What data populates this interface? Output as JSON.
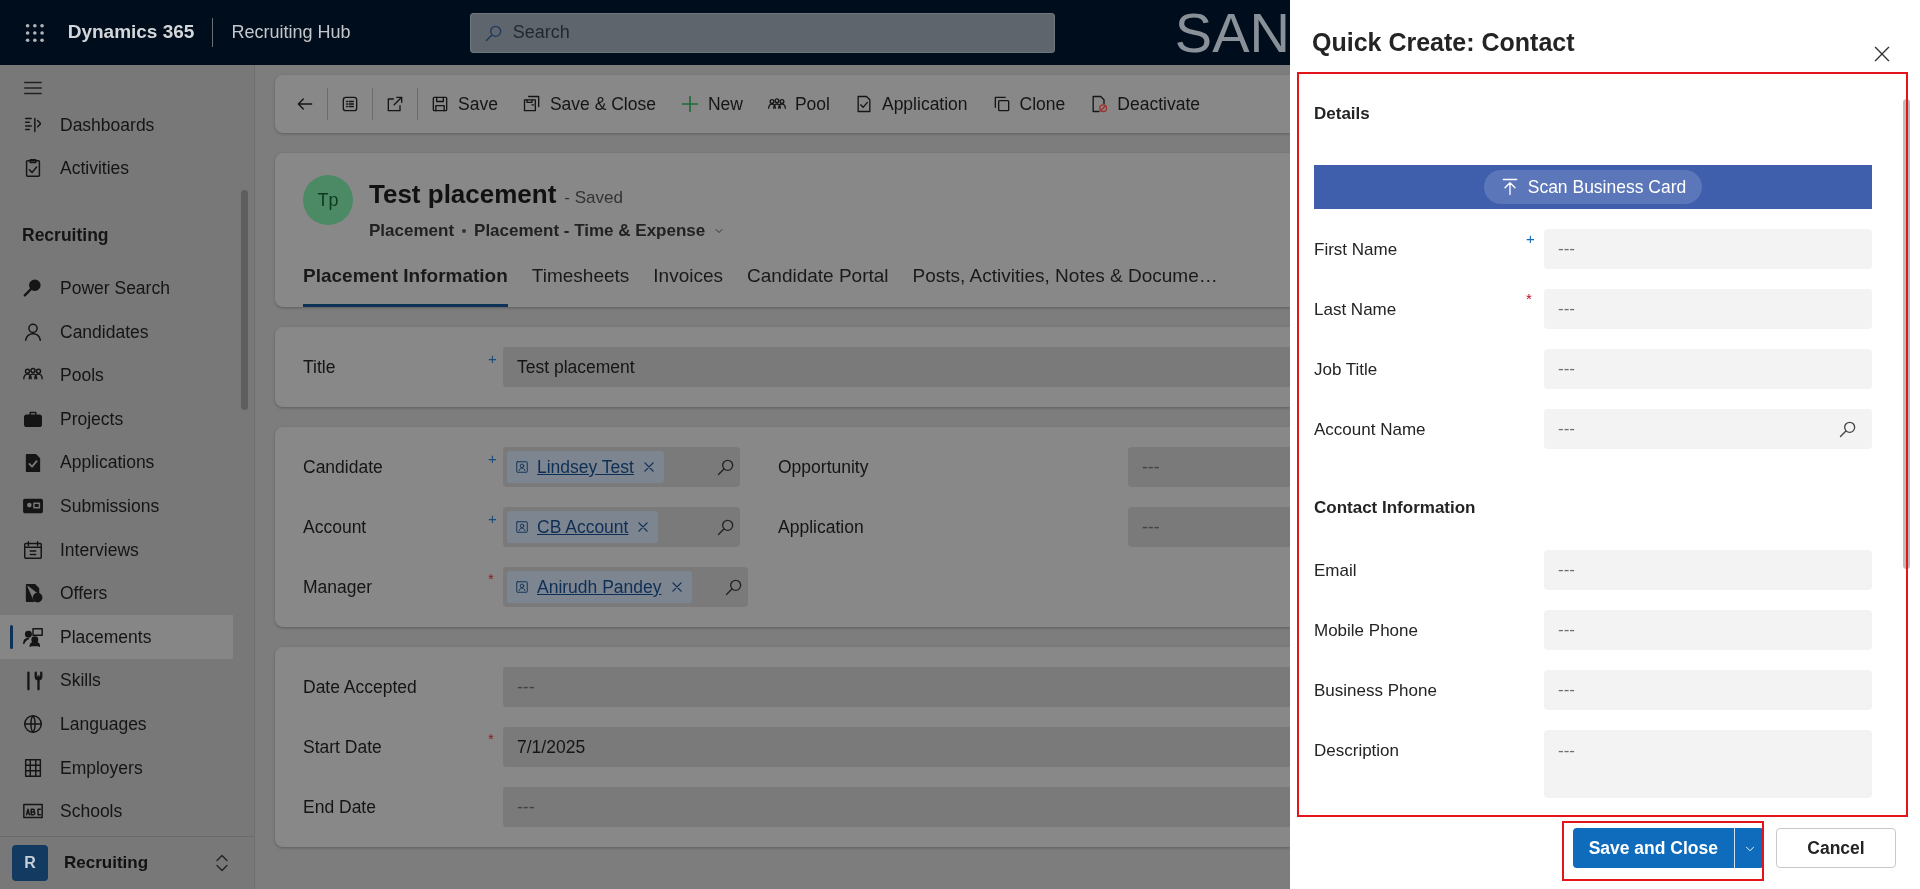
{
  "header": {
    "app_name": "Dynamics 365",
    "area": "Recruiting Hub",
    "search_placeholder": "Search",
    "banner": "SAN"
  },
  "sidebar": {
    "top_items": [
      {
        "label": "Dashboards",
        "selected": false
      },
      {
        "label": "Activities",
        "selected": false
      }
    ],
    "group": "Recruiting",
    "items": [
      {
        "label": "Power Search",
        "selected": false
      },
      {
        "label": "Candidates",
        "selected": false
      },
      {
        "label": "Pools",
        "selected": false
      },
      {
        "label": "Projects",
        "selected": false
      },
      {
        "label": "Applications",
        "selected": false
      },
      {
        "label": "Submissions",
        "selected": false
      },
      {
        "label": "Interviews",
        "selected": false
      },
      {
        "label": "Offers",
        "selected": false
      },
      {
        "label": "Placements",
        "selected": true
      },
      {
        "label": "Skills",
        "selected": false
      },
      {
        "label": "Languages",
        "selected": false
      },
      {
        "label": "Employers",
        "selected": false
      },
      {
        "label": "Schools",
        "selected": false
      }
    ],
    "area_switcher": {
      "initial": "R",
      "label": "Recruiting"
    }
  },
  "command_bar": [
    {
      "label": "Save"
    },
    {
      "label": "Save & Close"
    },
    {
      "label": "New"
    },
    {
      "label": "Pool"
    },
    {
      "label": "Application"
    },
    {
      "label": "Clone"
    },
    {
      "label": "Deactivate"
    }
  ],
  "record": {
    "initials": "Tp",
    "title": "Test placement",
    "status": "- Saved",
    "entity": "Placement",
    "form": "Placement - Time & Expense",
    "tabs": [
      {
        "label": "Placement Information",
        "selected": true
      },
      {
        "label": "Timesheets",
        "selected": false
      },
      {
        "label": "Invoices",
        "selected": false
      },
      {
        "label": "Candidate Portal",
        "selected": false
      },
      {
        "label": "Posts, Activities, Notes & Docume…",
        "selected": false
      }
    ]
  },
  "sections": [
    {
      "columns": [
        [
          {
            "label": "Title",
            "mark": "+",
            "required": false,
            "kind": "text",
            "value": "Test placement"
          }
        ]
      ]
    },
    {
      "columns": [
        [
          {
            "label": "Candidate",
            "mark": "+",
            "required": false,
            "kind": "lookup",
            "value": "Lindsey Test"
          },
          {
            "label": "Account",
            "mark": "+",
            "required": false,
            "kind": "lookup",
            "value": "CB Account"
          },
          {
            "label": "Manager",
            "mark": "*",
            "required": true,
            "kind": "lookup",
            "value": "Anirudh Pandey"
          }
        ],
        [
          {
            "label": "Opportunity",
            "kind": "lookup",
            "placeholder": "---"
          },
          {
            "label": "Application",
            "kind": "lookup",
            "placeholder": "---"
          }
        ]
      ]
    },
    {
      "columns": [
        [
          {
            "label": "Date Accepted",
            "kind": "text",
            "placeholder": "---"
          },
          {
            "label": "Start Date",
            "mark": "*",
            "required": true,
            "kind": "text",
            "value": "7/1/2025"
          },
          {
            "label": "End Date",
            "kind": "text",
            "placeholder": "---"
          }
        ]
      ]
    }
  ],
  "quick_create": {
    "title": "Quick Create: Contact",
    "sections": [
      {
        "heading": "Details",
        "scan_button": "Scan Business Card",
        "fields": [
          {
            "label": "First Name",
            "mark": "+",
            "required": false,
            "kind": "text",
            "placeholder": "---"
          },
          {
            "label": "Last Name",
            "mark": "*",
            "required": true,
            "kind": "text",
            "placeholder": "---"
          },
          {
            "label": "Job Title",
            "kind": "text",
            "placeholder": "---"
          },
          {
            "label": "Account Name",
            "kind": "lookup",
            "placeholder": "---"
          }
        ]
      },
      {
        "heading": "Contact Information",
        "fields": [
          {
            "label": "Email",
            "kind": "text",
            "placeholder": "---"
          },
          {
            "label": "Mobile Phone",
            "kind": "text",
            "placeholder": "---"
          },
          {
            "label": "Business Phone",
            "kind": "text",
            "placeholder": "---"
          },
          {
            "label": "Description",
            "kind": "multiline",
            "placeholder": "---"
          }
        ]
      }
    ],
    "save_button": "Save and Close",
    "cancel_button": "Cancel"
  }
}
